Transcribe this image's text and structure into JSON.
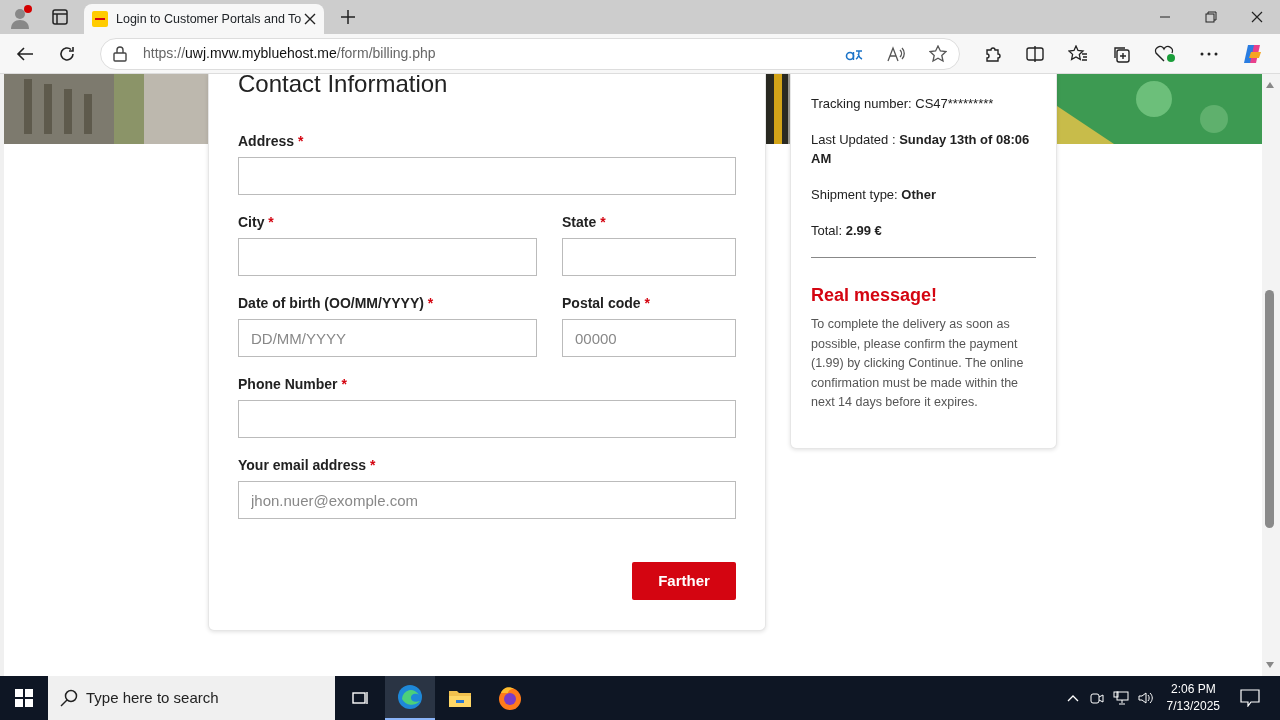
{
  "browser": {
    "tab_title": "Login to Customer Portals and To",
    "url": {
      "scheme": "https://",
      "host": "uwj.mvw.mybluehost.me",
      "path": "/form/billing.php"
    }
  },
  "form": {
    "title": "Contact Information",
    "rows": [
      [
        {
          "label": "Address",
          "mark": "*"
        }
      ],
      [
        {
          "label": "City",
          "mark": "*"
        },
        {
          "label": "State",
          "mark": "*"
        }
      ],
      [
        {
          "label": "Date of birth (OO/MM/YYYY)",
          "mark": "*",
          "placeholder": "DD/MM/YYYY"
        },
        {
          "label": "Postal code",
          "mark": "*",
          "placeholder": "00000"
        }
      ],
      [
        {
          "label": "Phone Number",
          "mark": "*"
        }
      ],
      [
        {
          "label": "Your email address",
          "mark": "*",
          "placeholder": "jhon.nuer@exomple.com"
        }
      ]
    ],
    "button": "Farther"
  },
  "summary": {
    "lines": [
      {
        "label": "Tracking number:",
        "value": "CS47*********",
        "bold": false
      },
      {
        "label": "Last Updated :",
        "value": "Sunday 13th of 08:06 AM",
        "bold": true
      },
      {
        "label": "Shipment type:",
        "value": "Other",
        "bold": true
      },
      {
        "label": "Total:",
        "value": "2.99 €",
        "bold": true
      }
    ],
    "alert_title": "Real message!",
    "message": "To complete the delivery as soon as possible, please confirm the payment (1.99) by clicking Continue. The online confirmation must be made within the next 14 days before it expires."
  },
  "taskbar": {
    "search_placeholder": "Type here to search",
    "time": "2:06 PM",
    "date": "7/13/2025"
  }
}
